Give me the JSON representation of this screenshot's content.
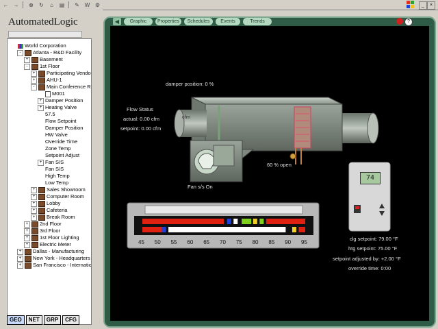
{
  "toolbar": {
    "buttons": [
      "back-icon",
      "forward-icon",
      "stop-icon",
      "refresh-icon",
      "home-icon",
      "print-icon",
      "edit-icon",
      "word-icon",
      "tools-icon"
    ]
  },
  "brand": "AutomatedLogic",
  "tree": [
    {
      "label": "World Corporation",
      "depth": 0,
      "icon": "world",
      "expander": ""
    },
    {
      "label": "Atlanta - R&D Facility",
      "depth": 1,
      "icon": "bldg",
      "expander": "-"
    },
    {
      "label": "Basement",
      "depth": 2,
      "icon": "bldg",
      "expander": "+"
    },
    {
      "label": "1st Floor",
      "depth": 2,
      "icon": "bldg",
      "expander": "-"
    },
    {
      "label": "Participating Vendors",
      "depth": 3,
      "icon": "bldg",
      "expander": "+"
    },
    {
      "label": "AHU-1",
      "depth": 3,
      "icon": "bldg",
      "expander": "+"
    },
    {
      "label": "Main Conference Roo",
      "depth": 3,
      "icon": "bldg",
      "expander": "-"
    },
    {
      "label": "M001",
      "depth": 4,
      "icon": "doc",
      "expander": ""
    },
    {
      "label": "Damper Position",
      "depth": 4,
      "icon": "",
      "expander": "+"
    },
    {
      "label": "Heating Valve",
      "depth": 4,
      "icon": "",
      "expander": "+"
    },
    {
      "label": "57.5",
      "depth": 4,
      "icon": "",
      "expander": ""
    },
    {
      "label": "Flow Setpoint",
      "depth": 4,
      "icon": "",
      "expander": ""
    },
    {
      "label": "Damper Position",
      "depth": 4,
      "icon": "",
      "expander": ""
    },
    {
      "label": "HW Valve",
      "depth": 4,
      "icon": "",
      "expander": ""
    },
    {
      "label": "Override Time",
      "depth": 4,
      "icon": "",
      "expander": ""
    },
    {
      "label": "Zone Temp",
      "depth": 4,
      "icon": "",
      "expander": ""
    },
    {
      "label": "Setpoint Adjust",
      "depth": 4,
      "icon": "",
      "expander": ""
    },
    {
      "label": "Fan S/S",
      "depth": 4,
      "icon": "",
      "expander": "+"
    },
    {
      "label": "Fan S/S",
      "depth": 4,
      "icon": "",
      "expander": ""
    },
    {
      "label": "High Temp",
      "depth": 4,
      "icon": "",
      "expander": ""
    },
    {
      "label": "Low Temp",
      "depth": 4,
      "icon": "",
      "expander": ""
    },
    {
      "label": "Sales Showroom",
      "depth": 3,
      "icon": "bldg",
      "expander": "+"
    },
    {
      "label": "Computer Room",
      "depth": 3,
      "icon": "bldg",
      "expander": "+"
    },
    {
      "label": "Lobby",
      "depth": 3,
      "icon": "bldg",
      "expander": "+"
    },
    {
      "label": "Cafeteria",
      "depth": 3,
      "icon": "bldg",
      "expander": "+"
    },
    {
      "label": "Break Room",
      "depth": 3,
      "icon": "bldg",
      "expander": "+"
    },
    {
      "label": "2nd Floor",
      "depth": 2,
      "icon": "bldg",
      "expander": "+"
    },
    {
      "label": "3rd Floor",
      "depth": 2,
      "icon": "bldg",
      "expander": "+"
    },
    {
      "label": "1st Floor Lighting",
      "depth": 2,
      "icon": "bldg",
      "expander": "+"
    },
    {
      "label": "Electric Meter",
      "depth": 2,
      "icon": "bldg",
      "expander": "+"
    },
    {
      "label": "Dallas - Manufacturing",
      "depth": 1,
      "icon": "bldg",
      "expander": "+"
    },
    {
      "label": "New York - Headquarters",
      "depth": 1,
      "icon": "bldg",
      "expander": "+"
    },
    {
      "label": "San Francisco - Internationa",
      "depth": 1,
      "icon": "bldg",
      "expander": "+"
    }
  ],
  "bottom_tabs": [
    "GEO",
    "NET",
    "GRP",
    "CFG"
  ],
  "nav_tabs": [
    "Graphic",
    "Properties",
    "Schedules",
    "Events",
    "Trends"
  ],
  "graphic": {
    "damper_position": "damper position: 0 %",
    "flow_status": "Flow Status",
    "flow_actual": "actual:  0.00 cfm",
    "flow_setpoint": "setpoint:  0.00 cfm",
    "cfm_label": "cfm",
    "valve_open": "60 % open",
    "fan_status": "Fan s/s  On",
    "thermostat_display": "74",
    "clg_setpoint": "clg setpoint:  79.00 °F",
    "htg_setpoint": "htg setpoint:  75.00 °F",
    "setpoint_adjusted": "setpoint adjusted by:  +2.00 °F",
    "override_time": "override time:   0:00"
  },
  "temp_scale": {
    "ticks": [
      "45",
      "50",
      "55",
      "60",
      "65",
      "70",
      "75",
      "80",
      "85",
      "90",
      "95"
    ]
  },
  "colors": {
    "frame": "#2e5c46",
    "nav_button": "#b5d9c0",
    "bar_red": "#e02010",
    "bar_yellow": "#f0d020",
    "bar_green": "#80d020",
    "bar_blue": "#2040e0"
  }
}
